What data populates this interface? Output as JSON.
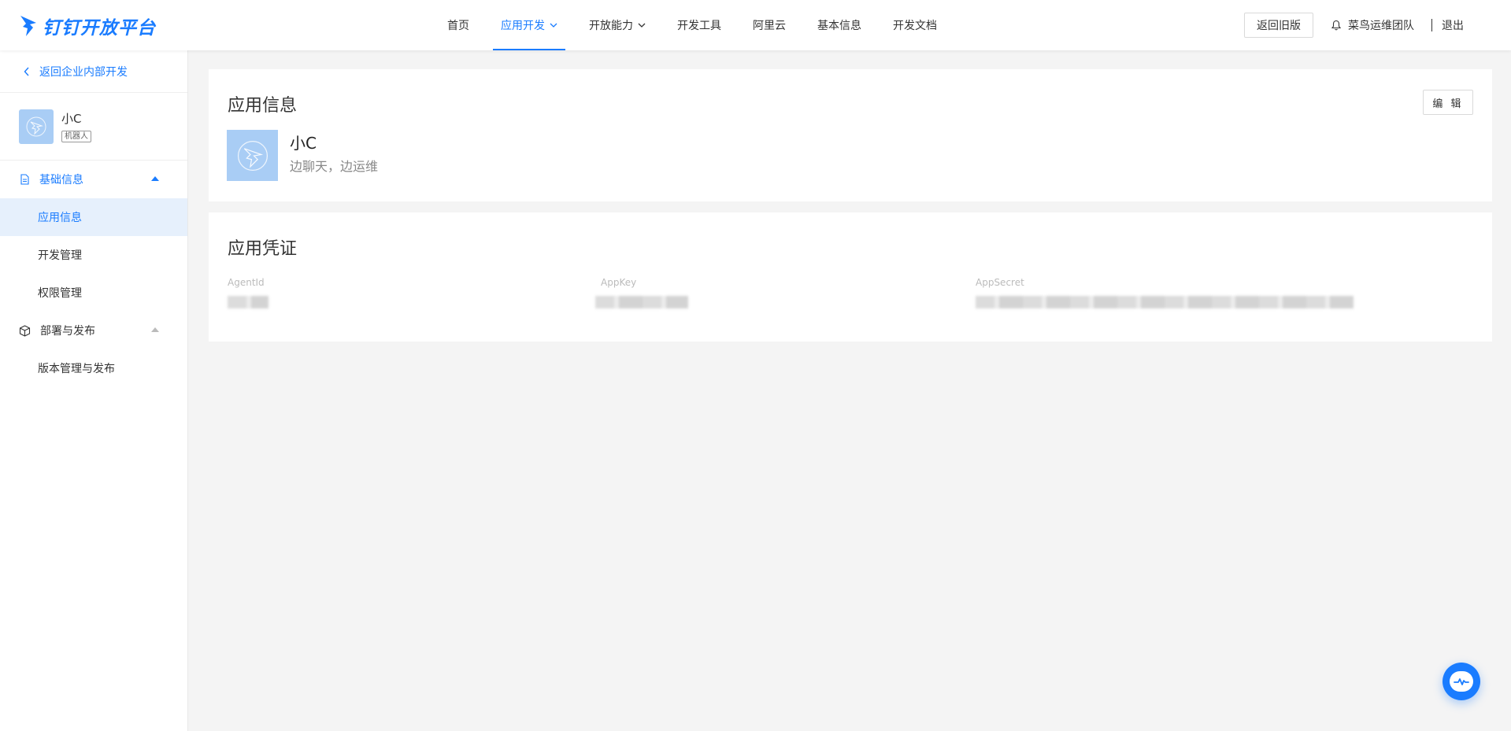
{
  "brand": {
    "logo_text": "钉钉开放平台",
    "color": "#1a7cff"
  },
  "nav": {
    "items": [
      {
        "label": "首页",
        "dropdown": false,
        "active": false
      },
      {
        "label": "应用开发",
        "dropdown": true,
        "active": true
      },
      {
        "label": "开放能力",
        "dropdown": true,
        "active": false
      },
      {
        "label": "开发工具",
        "dropdown": false,
        "active": false
      },
      {
        "label": "阿里云",
        "dropdown": false,
        "active": false
      },
      {
        "label": "基本信息",
        "dropdown": false,
        "active": false
      },
      {
        "label": "开发文档",
        "dropdown": false,
        "active": false
      }
    ]
  },
  "header": {
    "old_version_label": "返回旧版",
    "team_name": "菜鸟运维团队",
    "logout_label": "退出"
  },
  "sidebar": {
    "back_label": "返回企业内部开发",
    "app_name": "小C",
    "app_badge": "机器人",
    "groups": [
      {
        "label": "基础信息",
        "icon": "document-icon",
        "expanded": true,
        "items": [
          {
            "label": "应用信息",
            "active": true
          },
          {
            "label": "开发管理",
            "active": false
          },
          {
            "label": "权限管理",
            "active": false
          }
        ]
      },
      {
        "label": "部署与发布",
        "icon": "cube-icon",
        "expanded": true,
        "items": [
          {
            "label": "版本管理与发布",
            "active": false
          }
        ]
      }
    ]
  },
  "app_info": {
    "title": "应用信息",
    "edit_label": "编 辑",
    "name": "小C",
    "description": "边聊天，边运维"
  },
  "credentials": {
    "title": "应用凭证",
    "fields": [
      {
        "label": "AgentId"
      },
      {
        "label": "AppKey"
      },
      {
        "label": "AppSecret"
      }
    ]
  },
  "floating_help": {
    "icon": "chat-help-icon"
  }
}
